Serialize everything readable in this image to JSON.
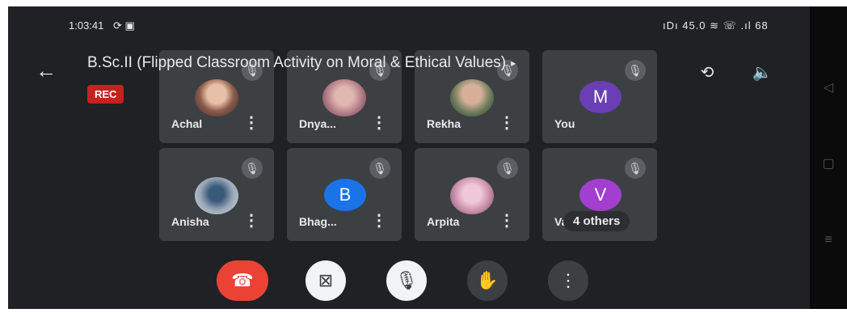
{
  "status_bar": {
    "time": "1:03:41",
    "left_icons": "⟳ ▣",
    "right_icons": "ıDı 45.0 ≋ ☏ .ıl 68"
  },
  "meeting": {
    "title": "B.Sc.II (Flipped Classroom Activity on Moral & Ethical Values)",
    "title_arrow": "▸",
    "rec_label": "REC"
  },
  "participants": [
    {
      "name": "Achal",
      "avatar": "photo",
      "color": "#8d5a4a"
    },
    {
      "name": "Dnya...",
      "avatar": "photo",
      "color": "#b07a86"
    },
    {
      "name": "Rekha",
      "avatar": "photo",
      "color": "#6b7b5a"
    },
    {
      "name": "You",
      "avatar": "M",
      "color": "#6a3fb5"
    },
    {
      "name": "Anisha",
      "avatar": "photo",
      "color": "#9aa8b8"
    },
    {
      "name": "Bhag...",
      "avatar": "B",
      "color": "#1a73e8"
    },
    {
      "name": "Arpita",
      "avatar": "photo",
      "color": "#c98ca8"
    },
    {
      "name": "Vai",
      "avatar": "V",
      "color": "#a23fd0"
    }
  ],
  "others_label": "4 others",
  "icons": {
    "back": "←",
    "more": "⋮",
    "switch_camera": "⟲",
    "speaker": "🔈",
    "mute": "🎙",
    "end_call": "☎",
    "camera_off": "⊠",
    "mic_off": "🎙",
    "raise_hand": "✋",
    "more_options": "⋮"
  },
  "colors": {
    "background": "#202124",
    "tile": "#3c4043",
    "end_call": "#ea4335",
    "rec": "#c5221f"
  }
}
